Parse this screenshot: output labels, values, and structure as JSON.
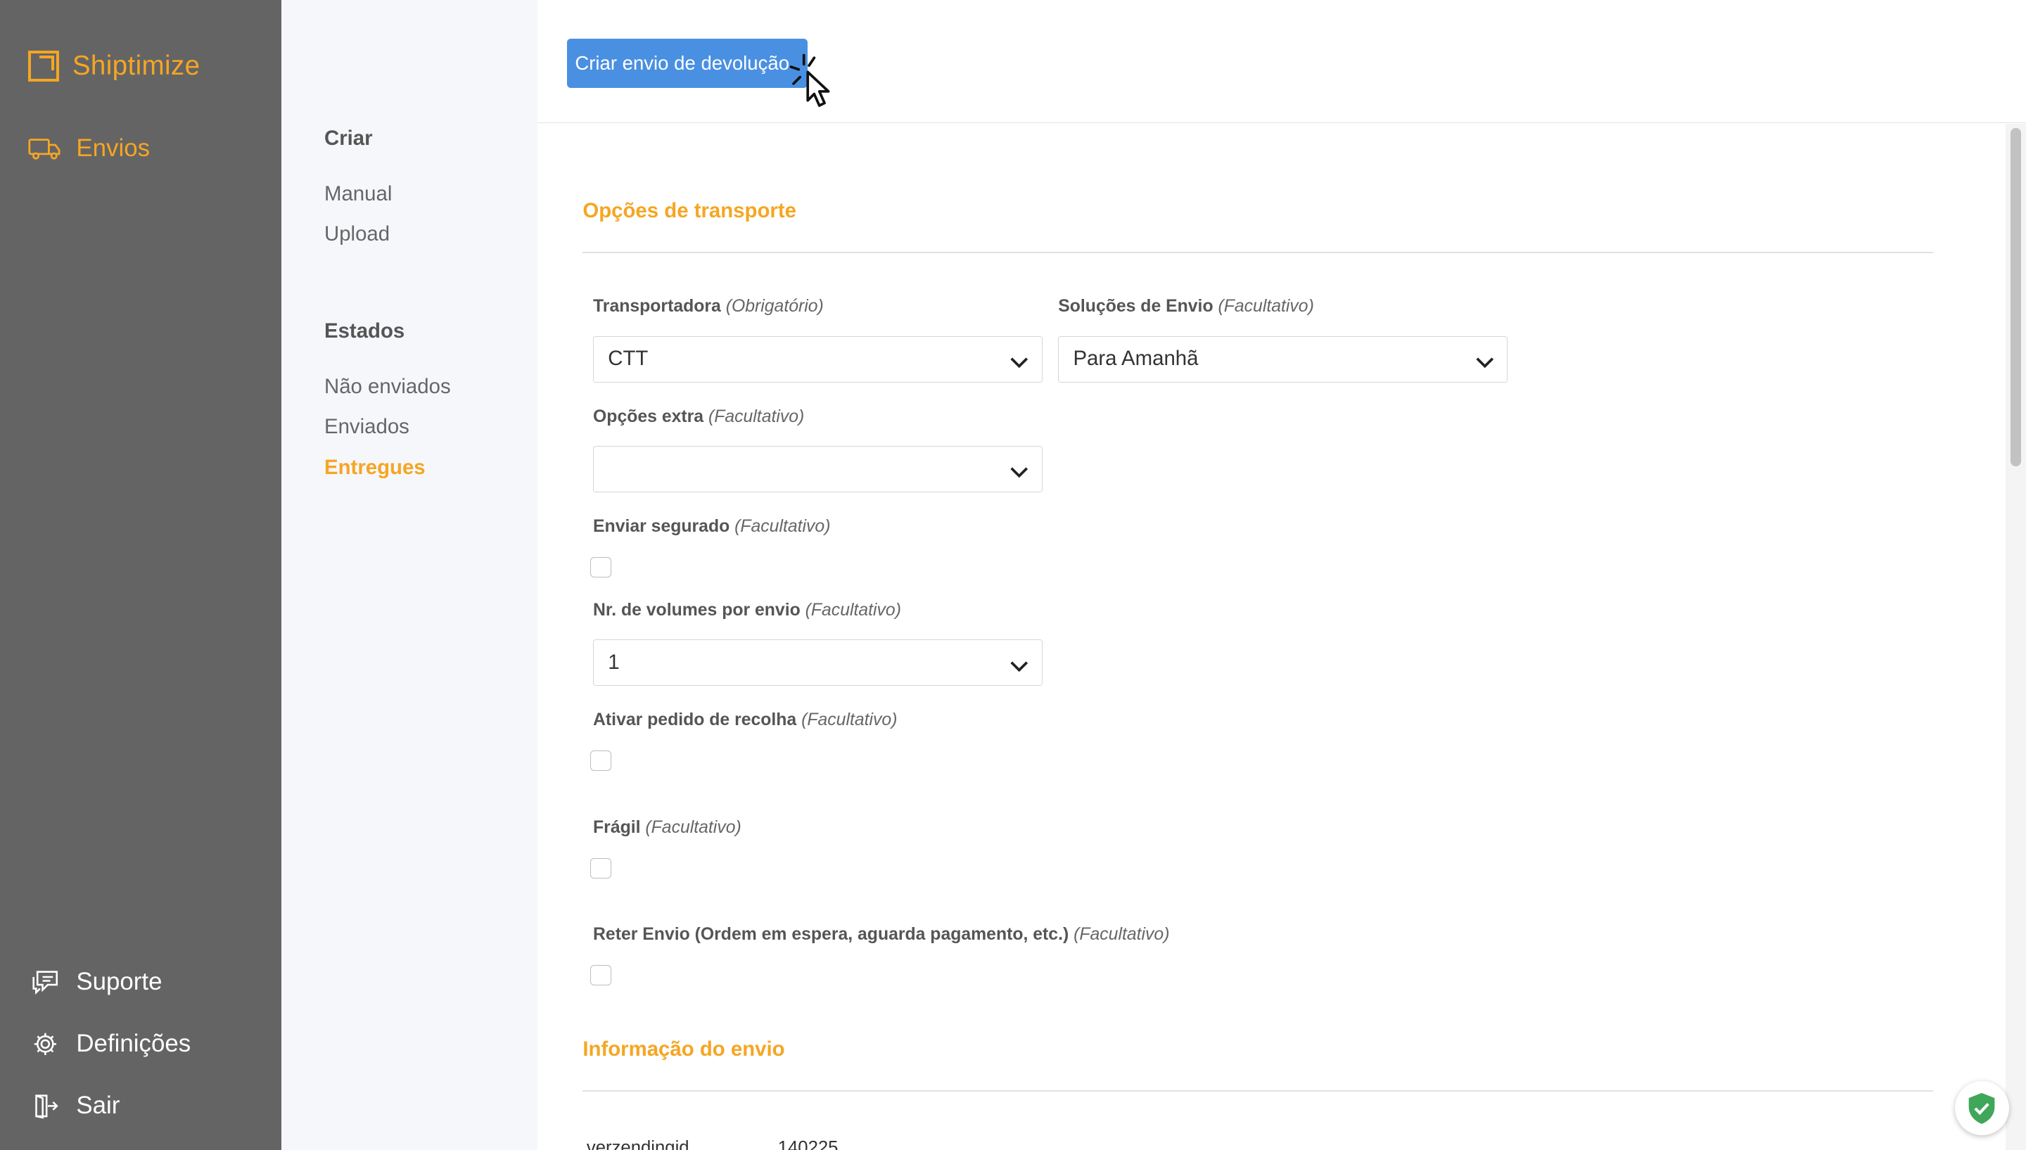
{
  "brand": {
    "name": "Shiptimize",
    "accent": "#f5a623"
  },
  "sidebar": {
    "main": {
      "label": "Envios",
      "icon": "truck-icon"
    },
    "bottom": [
      {
        "label": "Suporte",
        "icon": "chat-icon"
      },
      {
        "label": "Definições",
        "icon": "gear-icon"
      },
      {
        "label": "Sair",
        "icon": "logout-icon"
      }
    ]
  },
  "subnav": {
    "create_heading": "Criar",
    "create_links": [
      "Manual",
      "Upload"
    ],
    "states_heading": "Estados",
    "state_links": [
      "Não enviados",
      "Enviados",
      "Entregues"
    ],
    "active": "Entregues"
  },
  "topbar": {
    "return_button": "Criar envio de devolução"
  },
  "transport": {
    "title": "Opções de transporte",
    "carrier": {
      "label": "Transportadora",
      "note": "(Obrigatório)",
      "value": "CTT"
    },
    "solutions": {
      "label": "Soluções de Envio",
      "note": "(Facultativo)",
      "value": "Para Amanhã"
    },
    "extra": {
      "label": "Opções extra",
      "note": "(Facultativo)",
      "value": ""
    },
    "insured": {
      "label": "Enviar segurado",
      "note": "(Facultativo)",
      "checked": false
    },
    "volumes": {
      "label": "Nr. de volumes por envio",
      "note": "(Facultativo)",
      "value": "1"
    },
    "pickup": {
      "label": "Ativar pedido de recolha",
      "note": "(Facultativo)",
      "checked": false
    },
    "fragile": {
      "label": "Frágil",
      "note": "(Facultativo)",
      "checked": false
    },
    "hold": {
      "label": "Reter Envio (Ordem em espera, aguarda pagamento, etc.)",
      "note": "(Facultativo)",
      "checked": false
    }
  },
  "shipment_info": {
    "title": "Informação do envio",
    "rows": [
      {
        "key": "verzendingid",
        "value": "140225"
      }
    ]
  }
}
